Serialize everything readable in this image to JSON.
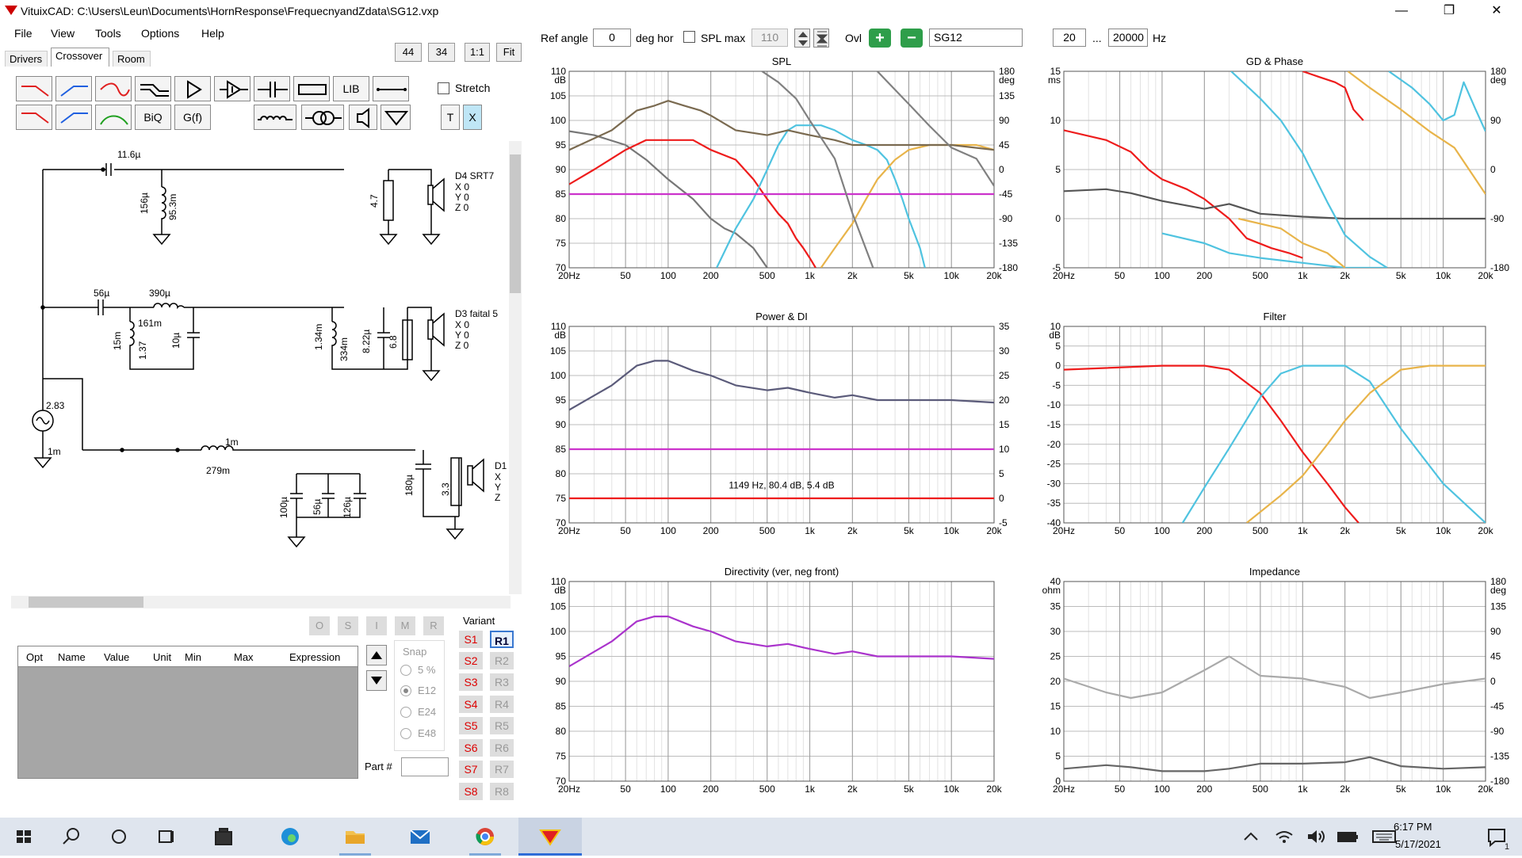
{
  "window": {
    "title": "VituixCAD: C:\\Users\\Leun\\Documents\\HornResponse\\FrequecnyandZdata\\SG12.vxp",
    "controls": {
      "minimize": "—",
      "restore": "❐",
      "close": "✕"
    }
  },
  "menu": [
    "File",
    "View",
    "Tools",
    "Options",
    "Help"
  ],
  "tabs": [
    "Drivers",
    "Crossover",
    "Room"
  ],
  "active_tab": "Crossover",
  "toolbar_buttons": {
    "b44": "44",
    "b34": "34",
    "b11": "1:1",
    "fit": "Fit"
  },
  "tools": {
    "lib": "LIB",
    "biq": "BiQ",
    "gf": "G(f)",
    "t": "T",
    "x": "X",
    "stretch_label": "Stretch"
  },
  "schematic": {
    "labels": {
      "c1": "11.6µ",
      "l1a": "156µ",
      "l1b": "95.3m",
      "r1": "4.7",
      "d4": "D4 SRT7",
      "xyz": [
        "X 0",
        "Y 0",
        "Z 0"
      ],
      "c2": "56µ",
      "l2": "390µ",
      "l2r": "161m",
      "l3a": "15m",
      "l3b": "1.37",
      "c3": "10µ",
      "l4a": "1.34m",
      "l4b": "334m",
      "c4": "8.22µ",
      "r2": "6.8",
      "d3": "D3 faital 5",
      "src_v": "2.83",
      "src_r": "1m",
      "l5": "1m",
      "l5r": "279m",
      "c5": "100µ",
      "c6": "56µ",
      "c7": "126µ",
      "c8": "180µ",
      "r3": "3.3",
      "d1": "D1",
      "d1xyz": [
        "X",
        "Y",
        "Z"
      ]
    }
  },
  "optimizer_buttons": [
    "O",
    "S",
    "I",
    "M",
    "R"
  ],
  "parts_table": {
    "columns": [
      "Opt",
      "Name",
      "Value",
      "Unit",
      "Min",
      "Max",
      "Expression"
    ]
  },
  "snap": {
    "title": "Snap",
    "options": [
      "5 %",
      "E12",
      "E24",
      "E48"
    ],
    "selected": "E12"
  },
  "part_number_label": "Part #",
  "variant": {
    "title": "Variant",
    "s": [
      "S1",
      "S2",
      "S3",
      "S4",
      "S5",
      "S6",
      "S7",
      "S8"
    ],
    "r": [
      "R1",
      "R2",
      "R3",
      "R4",
      "R5",
      "R6",
      "R7",
      "R8"
    ],
    "active": "R1"
  },
  "topbar": {
    "ref_angle_label": "Ref angle",
    "ref_angle": "0",
    "deg_hor": "deg hor",
    "spl_max_label": "SPL max",
    "spl_max": "110",
    "ovl_label": "Ovl",
    "overlay_name": "SG12",
    "freq_min": "20",
    "ellipsis": "...",
    "freq_max": "20000",
    "hz": "Hz"
  },
  "freq_ticks": [
    "20Hz",
    "50",
    "100",
    "200",
    "500",
    "1k",
    "2k",
    "5k",
    "10k",
    "20k"
  ],
  "chart_data": [
    {
      "title": "SPL",
      "type": "line",
      "x_scale": "log",
      "xlim": [
        20,
        20000
      ],
      "ylim": [
        70,
        110
      ],
      "y_ticks": [
        "110",
        "105",
        "100",
        "95",
        "90",
        "85",
        "80",
        "75",
        "70"
      ],
      "y_unit": "dB",
      "y2lim": [
        -180,
        180
      ],
      "y2_ticks": [
        "180",
        "135",
        "90",
        "45",
        "0",
        "-45",
        "-90",
        "-135",
        "-180"
      ],
      "y2_unit": "deg",
      "series": [
        {
          "color": "#777777",
          "axis": "left",
          "x": [
            20,
            30,
            50,
            70,
            100,
            150,
            200,
            250,
            300,
            400,
            500
          ],
          "y": [
            97.8,
            97,
            95,
            92,
            88,
            84,
            80,
            78,
            77,
            74,
            70
          ]
        },
        {
          "color": "#ee1c1c",
          "axis": "left",
          "x": [
            20,
            30,
            50,
            70,
            100,
            150,
            200,
            300,
            400,
            500,
            600,
            700,
            800,
            900,
            1000,
            1100
          ],
          "y": [
            87,
            90,
            94,
            96,
            96,
            96,
            94,
            92,
            88,
            84,
            81,
            79,
            76,
            74,
            72,
            70
          ]
        },
        {
          "color": "#4fc3e0",
          "axis": "left",
          "x": [
            220,
            300,
            400,
            500,
            600,
            700,
            800,
            1000,
            1200,
            1500,
            2000,
            2500,
            3000,
            3500,
            4000,
            4500,
            5000,
            6000,
            6500
          ],
          "y": [
            70,
            78,
            84,
            90,
            95,
            98,
            99,
            99,
            99,
            98,
            96,
            95,
            94,
            92,
            88,
            84,
            80,
            74,
            70
          ]
        },
        {
          "color": "#e8b44a",
          "axis": "left",
          "x": [
            1200,
            1500,
            2000,
            2500,
            3000,
            4000,
            5000,
            7000,
            10000,
            15000,
            20000
          ],
          "y": [
            70,
            74,
            79,
            84,
            88,
            92,
            94,
            95,
            95,
            95,
            94
          ]
        },
        {
          "color": "#7a6a50",
          "axis": "left",
          "x": [
            20,
            40,
            60,
            80,
            100,
            130,
            170,
            200,
            300,
            500,
            700,
            1000,
            1500,
            2000,
            3000,
            5000,
            8000,
            10000,
            20000
          ],
          "y": [
            94,
            98,
            102,
            103,
            104,
            103,
            102,
            101,
            98,
            97,
            98,
            97,
            96,
            95,
            95,
            95,
            95,
            95,
            94
          ]
        },
        {
          "color": "#cc33cc",
          "axis": "left",
          "x": [
            20,
            20000
          ],
          "y": [
            85,
            85
          ]
        },
        {
          "color": "#808080",
          "axis": "right",
          "x": [
            460,
            600,
            800,
            1000,
            1500,
            2000,
            2800
          ],
          "y": [
            180,
            160,
            130,
            90,
            20,
            -80,
            -180
          ]
        },
        {
          "color": "#808080",
          "axis": "right",
          "x": [
            3000,
            5000,
            7000,
            10000,
            15000,
            20000
          ],
          "y": [
            180,
            120,
            80,
            40,
            20,
            -30
          ]
        }
      ]
    },
    {
      "title": "GD & Phase",
      "type": "line",
      "x_scale": "log",
      "xlim": [
        20,
        20000
      ],
      "ylim": [
        -5,
        15
      ],
      "y_ticks": [
        "15",
        "10",
        "5",
        "0",
        "-5"
      ],
      "y_unit": "ms",
      "y2lim": [
        -180,
        180
      ],
      "y2_ticks": [
        "180",
        "90",
        "0",
        "-90",
        "-180"
      ],
      "y2_unit": "deg",
      "series": [
        {
          "color": "#ee1c1c",
          "axis": "left",
          "x": [
            20,
            40,
            60,
            80,
            100,
            150,
            200,
            300,
            400,
            600,
            800,
            1000
          ],
          "y": [
            9,
            8,
            6.8,
            5,
            4,
            3,
            2,
            0,
            -2,
            -3,
            -3.5,
            -4
          ]
        },
        {
          "color": "#555555",
          "axis": "left",
          "x": [
            20,
            40,
            60,
            100,
            200,
            300,
            500,
            1000,
            2000,
            5000,
            20000
          ],
          "y": [
            2.8,
            3,
            2.6,
            1.8,
            1,
            1.5,
            0.5,
            0.2,
            0,
            0,
            0
          ]
        },
        {
          "color": "#4fc3e0",
          "axis": "left",
          "x": [
            100,
            200,
            300,
            500,
            1000,
            2000,
            4000
          ],
          "y": [
            -1.5,
            -2.5,
            -3.5,
            -4,
            -4.5,
            -5,
            -5
          ]
        },
        {
          "color": "#4fc3e0",
          "axis": "right",
          "x": [
            310,
            500,
            700,
            1000,
            1500,
            2000,
            3000,
            4000
          ],
          "y": [
            180,
            130,
            90,
            30,
            -60,
            -120,
            -160,
            -180
          ]
        },
        {
          "color": "#4fc3e0",
          "axis": "right",
          "x": [
            4100,
            6000,
            8000,
            10000,
            12000,
            14000,
            17000,
            20000
          ],
          "y": [
            180,
            150,
            120,
            90,
            100,
            160,
            110,
            70
          ]
        },
        {
          "color": "#e8b44a",
          "axis": "left",
          "x": [
            350,
            700,
            1000,
            1500,
            2000
          ],
          "y": [
            0,
            -1,
            -2.5,
            -3.5,
            -5
          ]
        },
        {
          "color": "#e8b44a",
          "axis": "right",
          "x": [
            2100,
            3000,
            5000,
            8000,
            12000,
            20000
          ],
          "y": [
            180,
            150,
            110,
            70,
            40,
            -45
          ]
        },
        {
          "color": "#ee1c1c",
          "axis": "right",
          "x": [
            1000,
            1300,
            1700,
            2000,
            2300,
            2700
          ],
          "y": [
            180,
            170,
            160,
            150,
            110,
            90
          ]
        }
      ]
    },
    {
      "title": "Power & DI",
      "type": "line",
      "x_scale": "log",
      "xlim": [
        20,
        20000
      ],
      "ylim": [
        70,
        110
      ],
      "y_ticks": [
        "110",
        "105",
        "100",
        "95",
        "90",
        "85",
        "80",
        "75",
        "70"
      ],
      "y_unit": "dB",
      "y2lim": [
        -5,
        35
      ],
      "y2_ticks": [
        "35",
        "30",
        "25",
        "20",
        "15",
        "10",
        "5",
        "0",
        "-5"
      ],
      "annotation": "1149 Hz, 80.4 dB, 5.4 dB",
      "series": [
        {
          "color": "#5b5b7a",
          "axis": "left",
          "x": [
            20,
            40,
            60,
            80,
            100,
            150,
            200,
            300,
            500,
            700,
            1000,
            1500,
            2000,
            3000,
            5000,
            8000,
            10000,
            20000
          ],
          "y": [
            93,
            98,
            102,
            103,
            103,
            101,
            100,
            98,
            97,
            97.5,
            96.5,
            95.5,
            96,
            95,
            95,
            95,
            95,
            94.5
          ]
        },
        {
          "color": "#cc33cc",
          "axis": "left",
          "x": [
            20,
            20000
          ],
          "y": [
            85,
            85
          ]
        },
        {
          "color": "#ee1c1c",
          "axis": "left",
          "x": [
            20,
            20000
          ],
          "y": [
            75,
            75
          ]
        }
      ]
    },
    {
      "title": "Filter",
      "type": "line",
      "x_scale": "log",
      "xlim": [
        20,
        20000
      ],
      "ylim": [
        -40,
        10
      ],
      "y_ticks": [
        "10",
        "5",
        "0",
        "-5",
        "-10",
        "-15",
        "-20",
        "-25",
        "-30",
        "-35",
        "-40"
      ],
      "y_unit": "dB",
      "series": [
        {
          "color": "#ee1c1c",
          "axis": "left",
          "x": [
            20,
            100,
            200,
            300,
            500,
            700,
            1000,
            1500,
            2000,
            2500
          ],
          "y": [
            -1,
            0,
            0,
            -1,
            -7,
            -14,
            -22,
            -30,
            -36,
            -40
          ]
        },
        {
          "color": "#4fc3e0",
          "axis": "left",
          "x": [
            140,
            200,
            300,
            500,
            700,
            1000,
            1500,
            2000,
            3000,
            5000,
            10000,
            20000
          ],
          "y": [
            -40,
            -31,
            -21,
            -8,
            -2,
            0,
            0,
            0,
            -4,
            -16,
            -30,
            -40
          ]
        },
        {
          "color": "#e8b44a",
          "axis": "left",
          "x": [
            400,
            700,
            1000,
            1500,
            2000,
            3000,
            5000,
            8000,
            20000
          ],
          "y": [
            -40,
            -33,
            -28,
            -20,
            -14,
            -7,
            -1,
            0,
            0
          ]
        }
      ]
    },
    {
      "title": "Directivity (ver, neg front)",
      "type": "line",
      "x_scale": "log",
      "xlim": [
        20,
        20000
      ],
      "ylim": [
        70,
        110
      ],
      "y_ticks": [
        "110",
        "105",
        "100",
        "95",
        "90",
        "85",
        "80",
        "75",
        "70"
      ],
      "y_unit": "dB",
      "series": [
        {
          "color": "#aa33cc",
          "axis": "left",
          "x": [
            20,
            40,
            60,
            80,
            100,
            150,
            200,
            300,
            500,
            700,
            1000,
            1500,
            2000,
            3000,
            5000,
            8000,
            10000,
            20000
          ],
          "y": [
            93,
            98,
            102,
            103,
            103,
            101,
            100,
            98,
            97,
            97.5,
            96.5,
            95.5,
            96,
            95,
            95,
            95,
            95,
            94.5
          ]
        }
      ]
    },
    {
      "title": "Impedance",
      "type": "line",
      "x_scale": "log",
      "xlim": [
        20,
        20000
      ],
      "ylim": [
        0,
        40
      ],
      "y_ticks": [
        "40",
        "35",
        "30",
        "25",
        "20",
        "15",
        "10",
        "5",
        "0"
      ],
      "y_unit": "ohm",
      "y2lim": [
        -180,
        180
      ],
      "y2_ticks": [
        "180",
        "135",
        "90",
        "45",
        "0",
        "-45",
        "-90",
        "-135",
        "-180"
      ],
      "y2_unit": "deg",
      "series": [
        {
          "color": "#666666",
          "axis": "left",
          "x": [
            20,
            40,
            60,
            100,
            200,
            300,
            500,
            1000,
            2000,
            3000,
            5000,
            10000,
            20000
          ],
          "y": [
            2.5,
            3.2,
            2.8,
            2,
            2,
            2.5,
            3.5,
            3.5,
            3.8,
            4.8,
            3,
            2.5,
            2.8
          ]
        },
        {
          "color": "#aaaaaa",
          "axis": "right",
          "x": [
            20,
            40,
            60,
            100,
            200,
            300,
            500,
            1000,
            2000,
            3000,
            5000,
            10000,
            20000
          ],
          "y": [
            5,
            -20,
            -30,
            -20,
            20,
            45,
            10,
            5,
            -10,
            -30,
            -20,
            -5,
            5
          ]
        }
      ]
    }
  ],
  "taskbar": {
    "time": "6:17 PM",
    "date": "5/17/2021",
    "notification_count": "1"
  }
}
